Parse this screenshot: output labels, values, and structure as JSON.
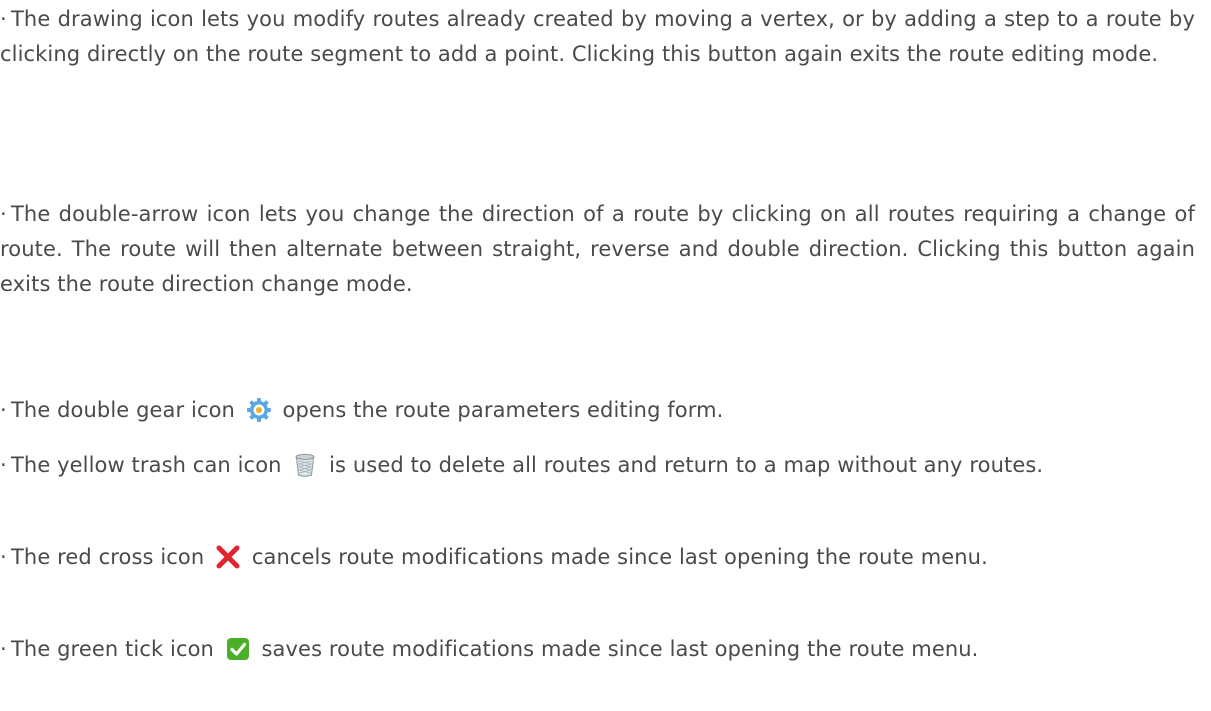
{
  "bullets": [
    {
      "text": "The drawing icon lets you modify routes already created by moving a vertex, or by adding a step to a route by clicking directly on the route segment to add a point. Clicking this button again exits the route editing mode."
    },
    {
      "text": "The double-arrow icon lets you change the direction of a route by clicking on all routes requiring a change of route. The route will then alternate between straight, reverse and double direction. Clicking this button again exits the route direction change mode."
    },
    {
      "before": "The double gear icon",
      "icon": "double-gear-icon",
      "after": "opens the route parameters editing form."
    },
    {
      "before": "The yellow trash can icon",
      "icon": "trash-can-icon",
      "after": "is used to delete all routes and return to a map without any routes."
    },
    {
      "before": "The red cross icon",
      "icon": "red-cross-icon",
      "after": "cancels route modifications made since last opening the route menu."
    },
    {
      "before": "The green tick icon",
      "icon": "green-tick-icon",
      "after": "saves route modifications made since last opening the route menu."
    }
  ],
  "colors": {
    "text": "#4a4a4a",
    "gear": "#5aa7e6",
    "cross": "#e0242f",
    "tick": "#4caf2a"
  }
}
